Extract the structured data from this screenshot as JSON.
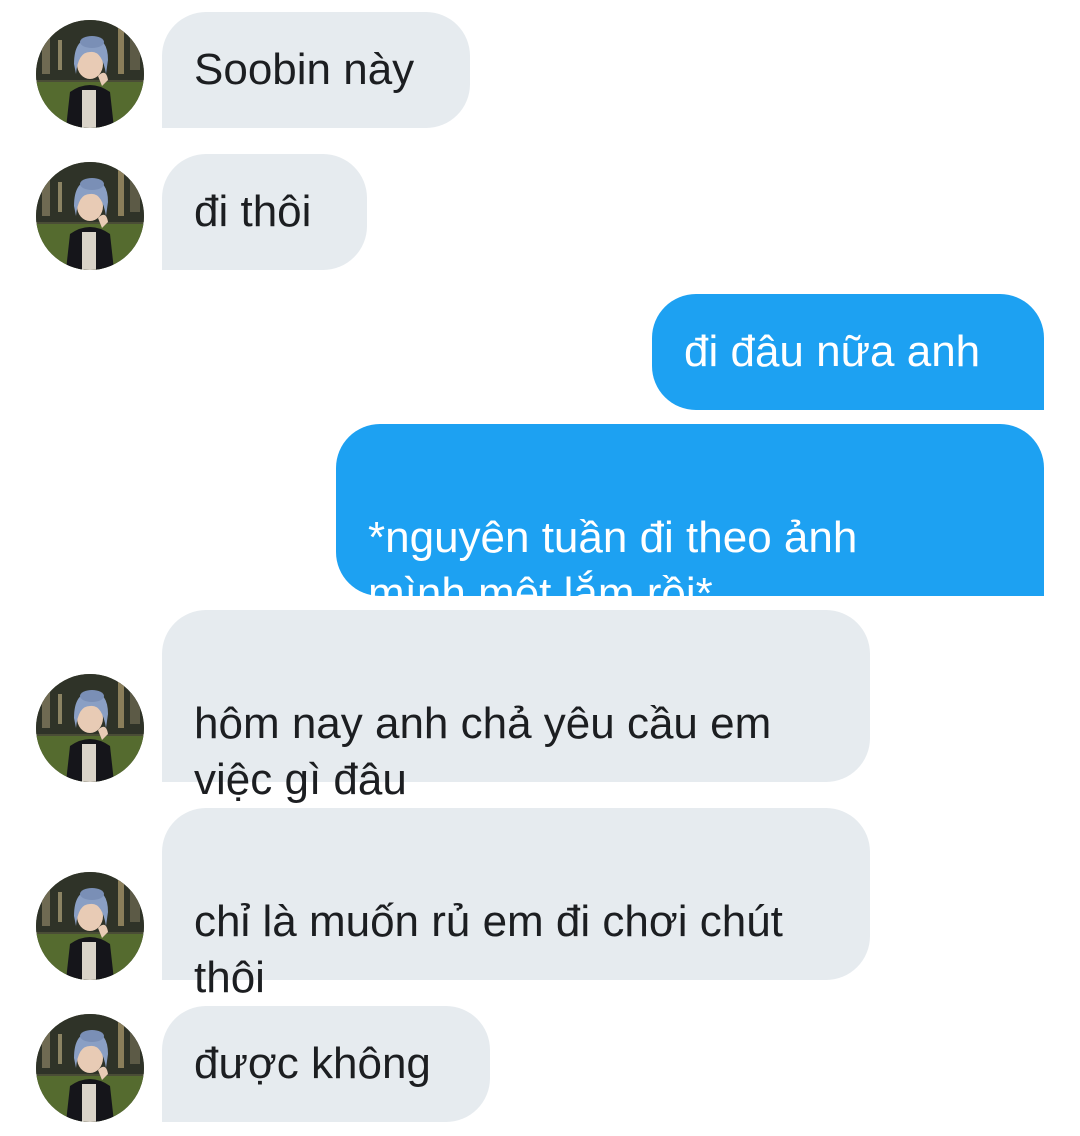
{
  "conversation": {
    "messages": [
      {
        "direction": "incoming",
        "text": "Soobin này",
        "avatar_icon": "profile-photo-icon"
      },
      {
        "direction": "incoming",
        "text": "đi thôi",
        "avatar_icon": "profile-photo-icon"
      },
      {
        "direction": "outgoing",
        "text": "đi đâu nữa anh"
      },
      {
        "direction": "outgoing",
        "text": "*nguyên tuần đi theo ảnh\nmình mệt lắm rồi*"
      },
      {
        "direction": "incoming",
        "text": "hôm nay anh chả yêu cầu em\nviệc gì đâu",
        "avatar_icon": "profile-photo-icon"
      },
      {
        "direction": "incoming",
        "text": "chỉ là muốn rủ em đi chơi chút\nthôi",
        "avatar_icon": "profile-photo-icon"
      },
      {
        "direction": "incoming",
        "text": "được không",
        "avatar_icon": "profile-photo-icon"
      }
    ]
  },
  "colors": {
    "incoming_bubble": "#e6ebef",
    "outgoing_bubble": "#1da1f2",
    "incoming_text": "#1c1e21",
    "outgoing_text": "#ffffff"
  }
}
